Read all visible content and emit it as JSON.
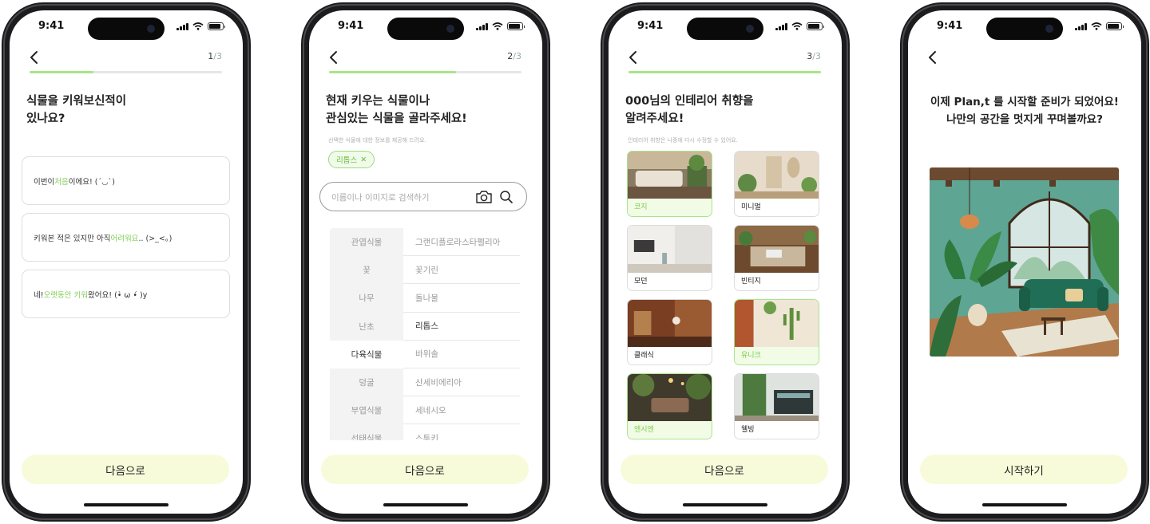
{
  "status_bar": {
    "time": "9:41"
  },
  "screens": [
    {
      "step": {
        "current": "1",
        "sep_total": "/3"
      },
      "progress": 0.33,
      "question": "식물을 키워보신적이\n있나요?",
      "options": [
        {
          "before": "이번이 ",
          "highlight": "처음",
          "after": "이에요! (´◡`)"
        },
        {
          "before": "키워본 적은 있지만 아직 ",
          "highlight": "어려워요",
          "after": ".. (>_<。)"
        },
        {
          "before": "네! ",
          "highlight": "오랫동안 키워",
          "after": "왔어요! (•̀ ω •́ )y"
        }
      ],
      "next_label": "다음으로"
    },
    {
      "step": {
        "current": "2",
        "sep_total": "/3"
      },
      "progress": 0.66,
      "question": "현재 키우는 식물이나\n관심있는 식물을 골라주세요!",
      "hint": "선택한 식물에 대한 정보를 제공해 드려요.",
      "chip_label": "리톱스",
      "search_placeholder": "이름이나 이미지로 검색하기",
      "categories": [
        "관엽식물",
        "꽃",
        "나무",
        "난초",
        "다육식물",
        "덩굴",
        "부엽식물",
        "선태식물"
      ],
      "selected_category": "다육식물",
      "plants": [
        "그랜디플로라스타펠리아",
        "꽃기린",
        "돌나물",
        "리톱스",
        "바위솔",
        "산세비에리아",
        "세네시오",
        "스투키"
      ],
      "selected_plant": "리톱스",
      "next_label": "다음으로"
    },
    {
      "step": {
        "current": "3",
        "sep_total": "/3"
      },
      "progress": 1.0,
      "question": "000님의 인테리어 취향을\n알려주세요!",
      "hint": "인테리어 취향은 나중에 다시 수정할 수 있어요.",
      "styles": [
        {
          "label": "코지",
          "selected": true
        },
        {
          "label": "미니멀",
          "selected": false
        },
        {
          "label": "모던",
          "selected": false
        },
        {
          "label": "빈티지",
          "selected": false
        },
        {
          "label": "클래식",
          "selected": false
        },
        {
          "label": "유니크",
          "selected": true
        },
        {
          "label": "앤시엔",
          "selected": true
        },
        {
          "label": "웰빙",
          "selected": false
        }
      ],
      "next_label": "다음으로"
    },
    {
      "message": "이제 Plan,t 를 시작할 준비가 되었어요!\n나만의 공간을 멋지게 꾸며볼까요?",
      "start_label": "시작하기"
    }
  ],
  "colors": {
    "accent": "#a9e58a",
    "accent_text": "#86cf5c",
    "button_bg": "#f8fbd9"
  }
}
